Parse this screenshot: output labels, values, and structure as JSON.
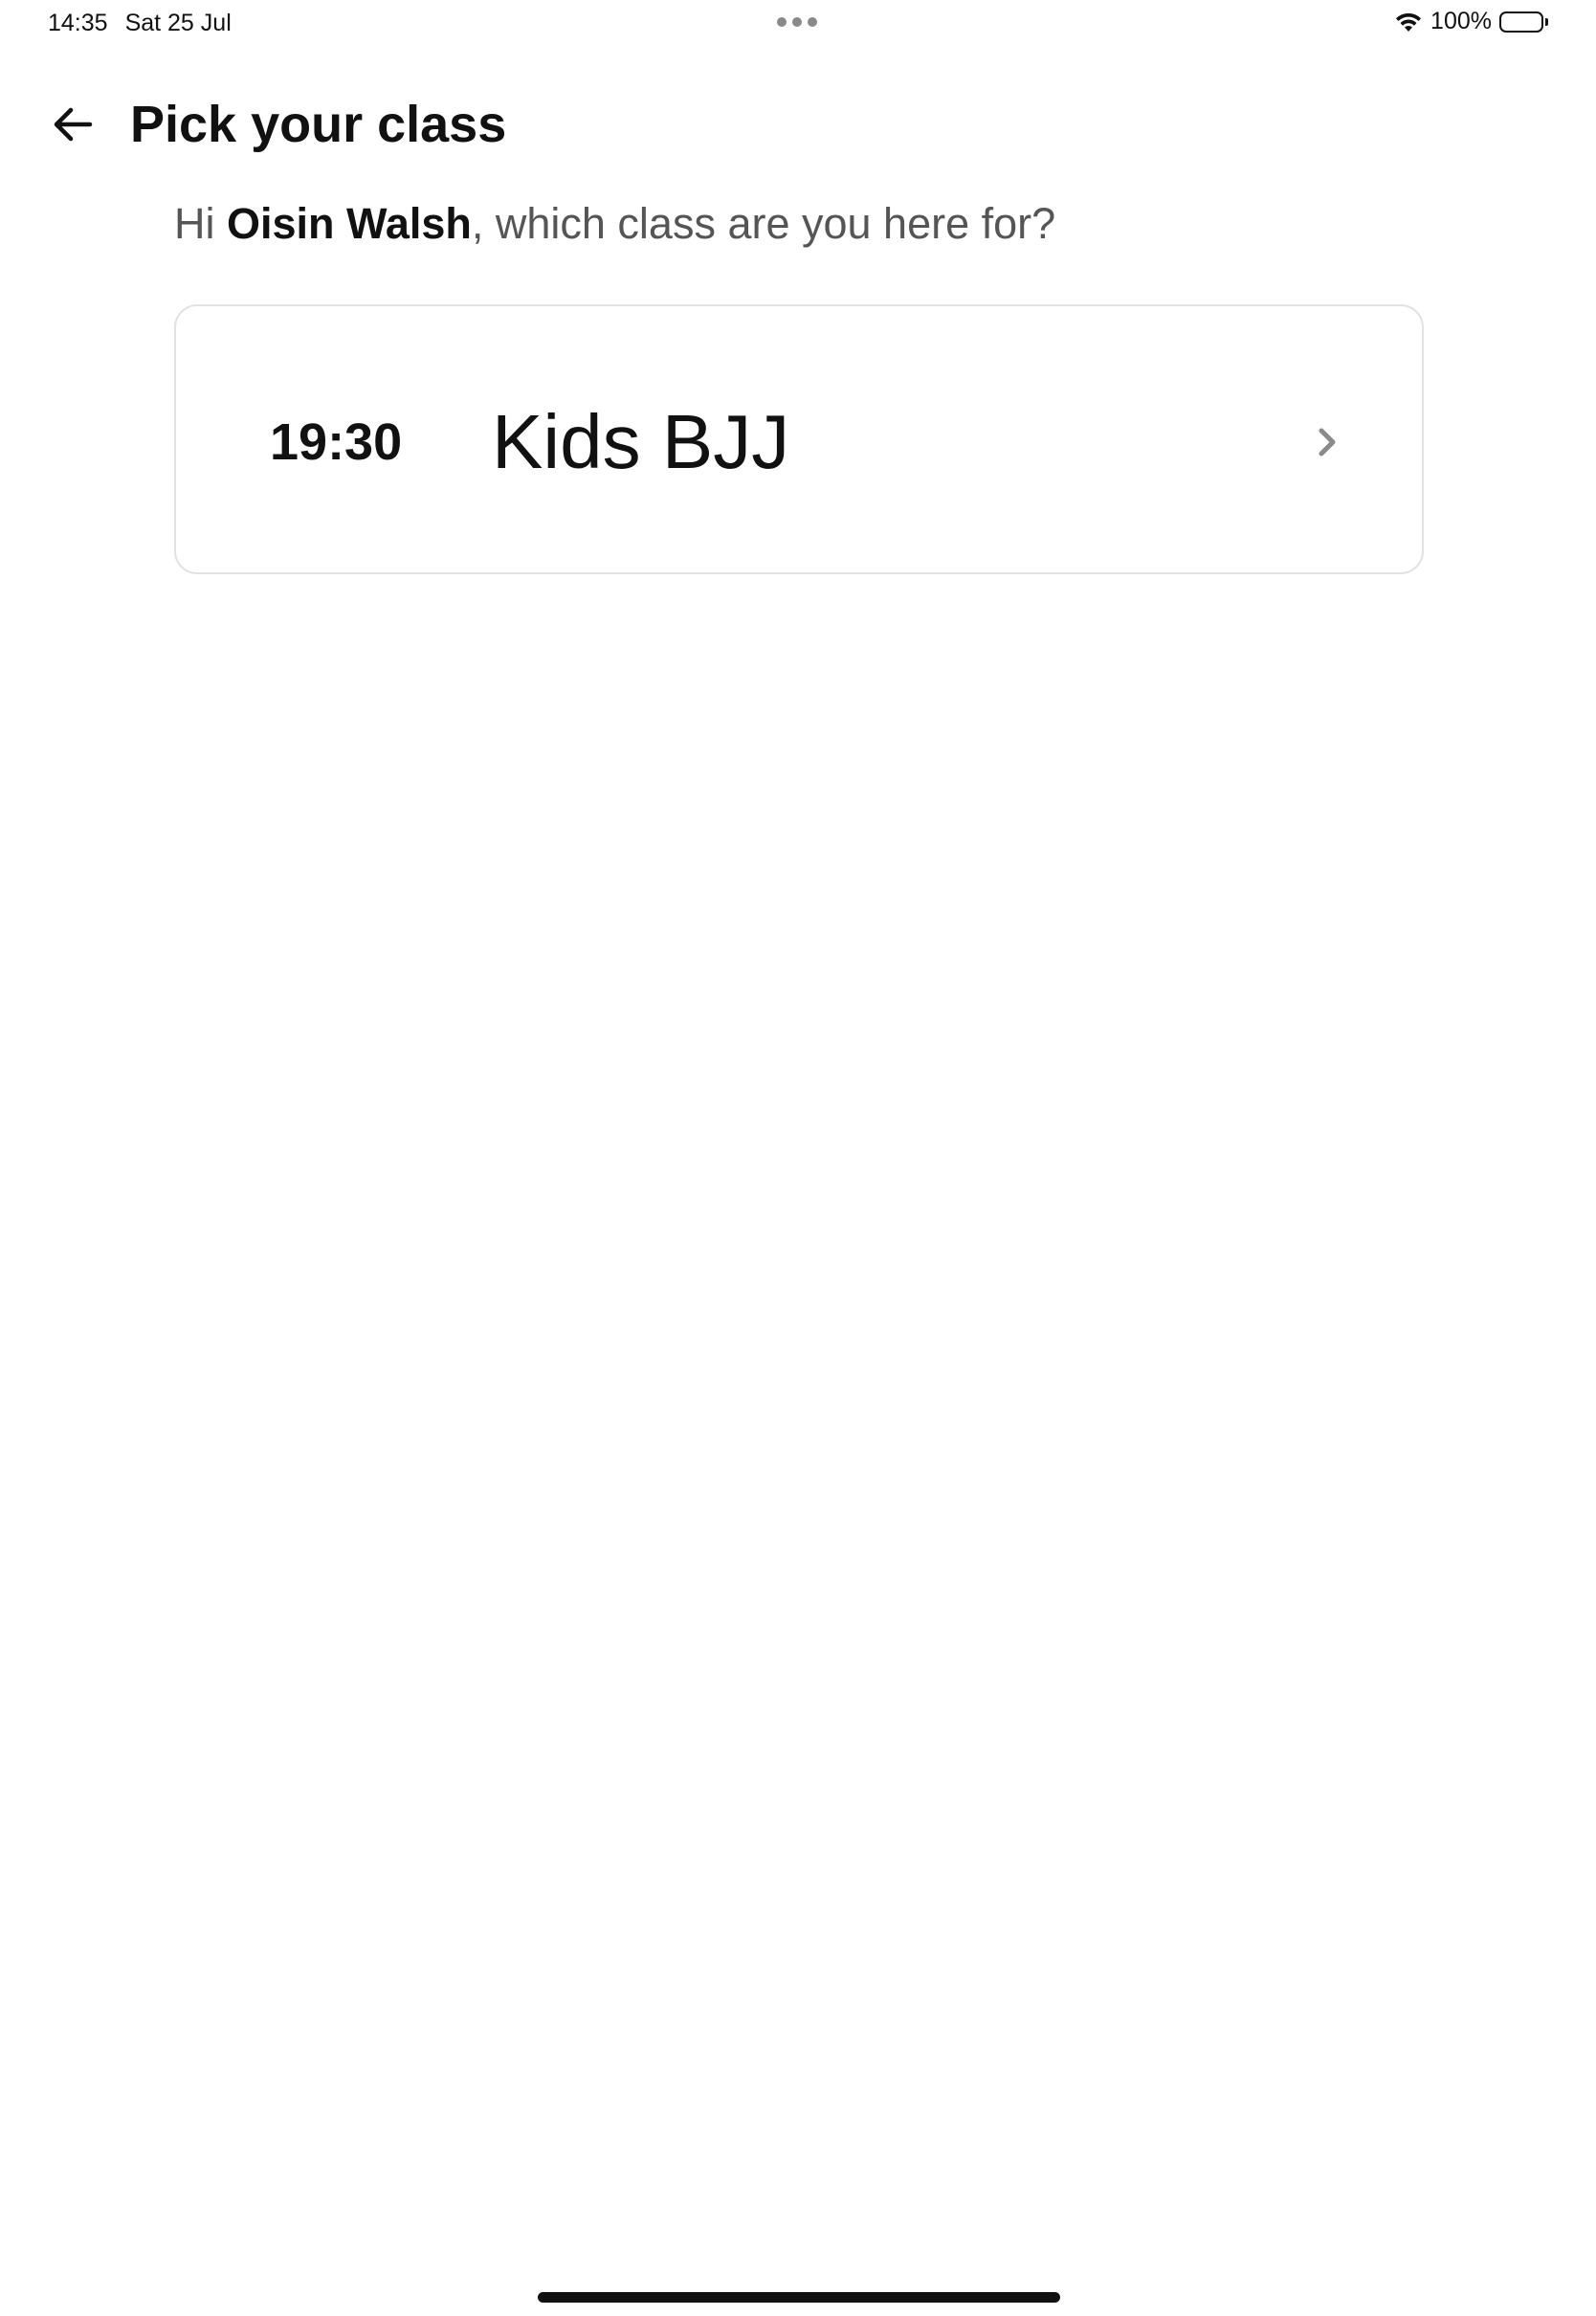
{
  "status_bar": {
    "time": "14:35",
    "date": "Sat 25 Jul",
    "battery_percent": "100%",
    "battery_level": 1.0
  },
  "header": {
    "title": "Pick your class",
    "back_icon": "arrow-left-icon"
  },
  "greeting": {
    "prefix": "Hi ",
    "user_name": "Oisin Walsh",
    "suffix": ", which class are you here for?"
  },
  "classes": [
    {
      "time": "19:30",
      "name": "Kids BJJ",
      "icon": "chevron-right-icon"
    }
  ]
}
